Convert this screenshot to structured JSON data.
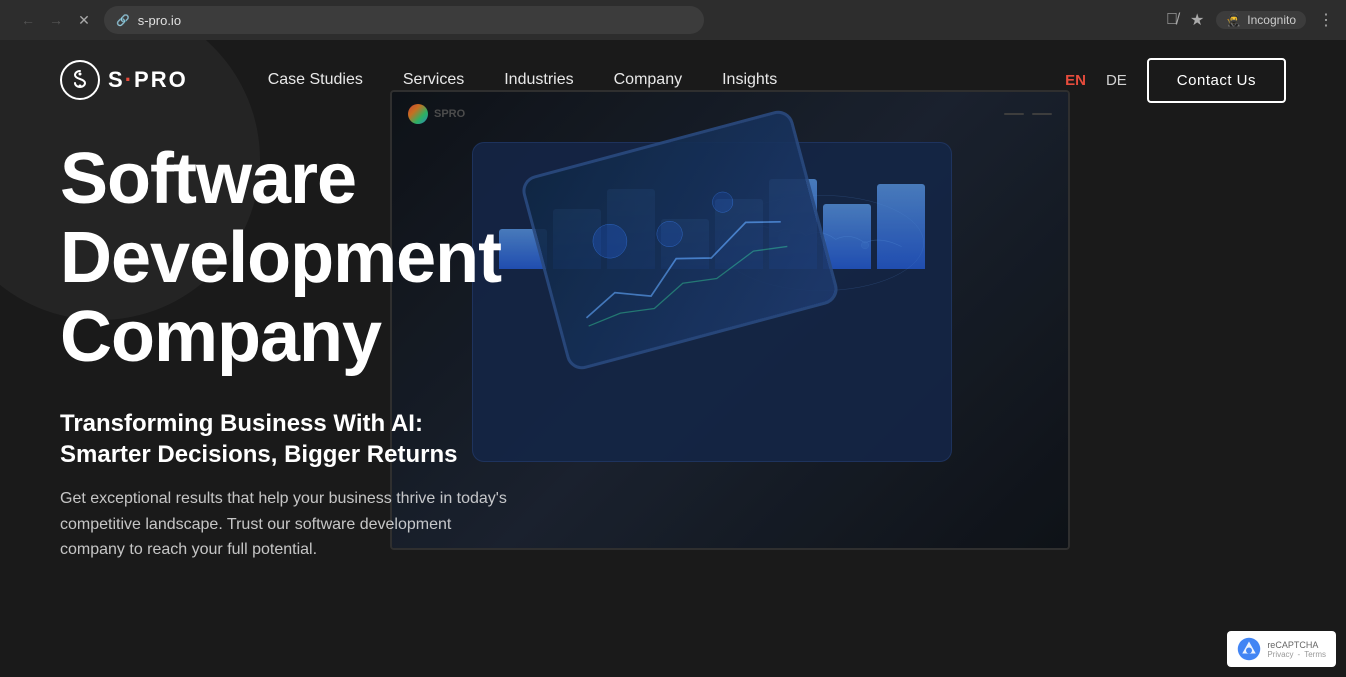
{
  "browser": {
    "url": "s-pro.io",
    "incognito_label": "Incognito",
    "back_disabled": false,
    "forward_disabled": false
  },
  "navbar": {
    "logo_text": "S·PRO",
    "logo_dot": "·",
    "nav_links": [
      {
        "label": "Case Studies",
        "id": "case-studies"
      },
      {
        "label": "Services",
        "id": "services"
      },
      {
        "label": "Industries",
        "id": "industries"
      },
      {
        "label": "Company",
        "id": "company"
      },
      {
        "label": "Insights",
        "id": "insights"
      }
    ],
    "lang_en": "EN",
    "lang_de": "DE",
    "contact_btn": "Contact Us"
  },
  "hero": {
    "title": "Software Development Company",
    "subtitle": "Transforming Business With AI: Smarter Decisions, Bigger Returns",
    "description": "Get exceptional results that help your business thrive in today's competitive landscape. Trust our software development company to reach your full potential."
  },
  "recaptcha": {
    "privacy_label": "Privacy",
    "terms_label": "Terms"
  }
}
